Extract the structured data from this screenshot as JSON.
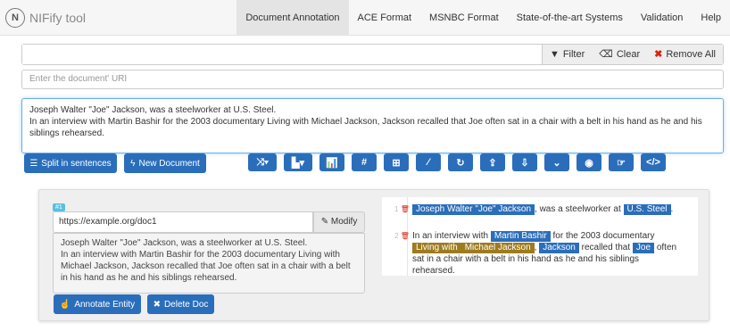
{
  "app": {
    "title": "NIFify tool",
    "logo_text": "N"
  },
  "nav": {
    "items": [
      {
        "label": "Document Annotation",
        "active": true
      },
      {
        "label": "ACE Format",
        "active": false
      },
      {
        "label": "MSNBC Format",
        "active": false
      },
      {
        "label": "State-of-the-art Systems",
        "active": false
      },
      {
        "label": "Validation",
        "active": false
      },
      {
        "label": "Help",
        "active": false
      }
    ]
  },
  "filter": {
    "value": "",
    "filter_label": "Filter",
    "clear_label": "Clear",
    "remove_all_label": "Remove All"
  },
  "uri_field": {
    "placeholder": "Enter the document' URI"
  },
  "doc_input": {
    "value": "Joseph Walter \"Joe\" Jackson, was a steelworker at U.S. Steel.\nIn an interview with Martin Bashir for the 2003 documentary Living with Michael Jackson, Jackson recalled that Joe often sat in a chair with a belt in his hand as he and his siblings rehearsed."
  },
  "buttons": {
    "split": "Split in sentences",
    "new_doc": "New Document",
    "annotate": "Annotate Entity",
    "delete_doc": "Delete Doc",
    "modify": "Modify"
  },
  "toolbar": {
    "icons": [
      "shuffle-icon",
      "sort-icon",
      "bar-chart-icon",
      "hash-icon",
      "puzzle-icon",
      "magic-wand-icon",
      "refresh-icon",
      "upload-icon",
      "download-icon",
      "chevron-down-icon",
      "eye-icon",
      "hand-icon",
      "code-icon"
    ],
    "glyphs": [
      "⤨▾",
      "▙▾",
      "📊",
      "#",
      "⊞",
      "⁄",
      "↻",
      "⇪",
      "⇩",
      "⌄",
      "◉",
      "☞",
      "</>"
    ]
  },
  "document": {
    "badge": "#1",
    "uri": "https://example.org/doc1",
    "text": "Joseph Walter \"Joe\" Jackson, was a steelworker at U.S. Steel.\nIn an interview with Martin Bashir for the 2003 documentary Living with Michael Jackson, Jackson recalled that Joe often sat in a chair with a belt in his hand as he and his siblings rehearsed.",
    "sentences": [
      {
        "num": "1",
        "parts": [
          {
            "t": "Joseph Walter \"Joe\" Jackson",
            "e": "blue"
          },
          {
            "t": ", was a steelworker at "
          },
          {
            "t": "U.S. Steel",
            "e": "blue"
          },
          {
            "t": "."
          }
        ]
      },
      {
        "num": "2",
        "parts": [
          {
            "t": "In an interview with "
          },
          {
            "t": "Martin Bashir",
            "e": "blue"
          },
          {
            "t": " for the 2003 documentary "
          },
          {
            "t": "Living with ",
            "e": "olive"
          },
          {
            "t": "Michael Jackson",
            "e": "olive"
          },
          {
            "t": ", "
          },
          {
            "t": "Jackson",
            "e": "blue"
          },
          {
            "t": " recalled that "
          },
          {
            "t": "Joe",
            "e": "blue"
          },
          {
            "t": " often sat in a chair with a belt in his hand as he and his siblings rehearsed."
          }
        ]
      }
    ]
  },
  "colors": {
    "primary": "#2a6ebb",
    "olive": "#9e7b1f",
    "danger": "#d9230f"
  }
}
